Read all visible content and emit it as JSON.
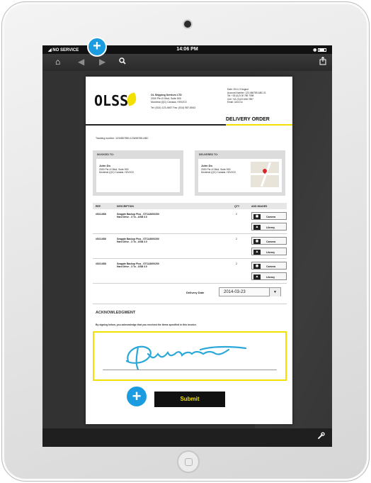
{
  "device": {
    "camera": "front-camera",
    "home_button": "home-button"
  },
  "status_bar": {
    "carrier": "NO SERVICE",
    "time": "14:06 PM"
  },
  "toolbar": {
    "home_icon": "home-icon",
    "back_icon": "back-icon",
    "forward_icon": "forward-icon",
    "search_icon": "search-icon",
    "share_icon": "share-icon"
  },
  "annotations": {
    "top_plus": "+",
    "bottom_plus": "+"
  },
  "company": {
    "logo": "OLSS",
    "name": "OL Shipping Services LTD",
    "address_line1": "2000 Pie-IX Blvd, Suite 500",
    "address_line2": "Montreal (QC) Canada, H0V2C0",
    "contact": "Tel: (514) 123-4567 Fax: (514) 987-6543"
  },
  "doc_meta": {
    "date": "Date: 2014, 5 August",
    "account": "Account Number: 123-456789-ABC-01",
    "tel": "Tel: +33 (0) 5 00 789 7098",
    "cell": "Cell: +41 (0)123 456 7897",
    "email": "Email: John Do"
  },
  "document": {
    "title": "DELIVERY ORDER",
    "tracking": "Tracking number: 1234567890-123456789-ABC"
  },
  "invoiced_to": {
    "label": "INVOICED TO:",
    "name": "John Do",
    "line1": "2000 Pie-IX Blvd, Suite 500",
    "line2": "Montreal (QC) Canada, H0V2C0"
  },
  "delivered_to": {
    "label": "DELIVERED TO:",
    "name": "John Do",
    "line1": "2000 Pie-IX Blvd, Suite 500",
    "line2": "Montreal (QC) Canada, H0V2C0"
  },
  "table": {
    "headers": {
      "ref": "REF.",
      "description": "DESCRIPTION",
      "qty": "QTY",
      "add_images": "ADD IMAGES"
    },
    "rows": [
      {
        "ref": "#521458",
        "desc1": "Seagate Backup Plus - STCA3000200",
        "desc2": "Hard Drive - 3 To - USB 3.0",
        "qty": "2"
      },
      {
        "ref": "#521458",
        "desc1": "Seagate Backup Plus - STCA3000200",
        "desc2": "Hard Drive - 3 To - USB 3.0",
        "qty": "2"
      },
      {
        "ref": "#521458",
        "desc1": "Seagate Backup Plus - STCA3000200",
        "desc2": "Hard Drive - 3 To - USB 3.0",
        "qty": "2"
      }
    ],
    "camera_label": "Camera",
    "library_label": "Library"
  },
  "delivery_date": {
    "label": "Delivery Date",
    "value": "2014-03-23"
  },
  "acknowledgment": {
    "title": "ACKNOWLEDGMENT",
    "text": "By signing below, you acknowledge that you received the items specified in this invoice."
  },
  "submit_label": "Submit",
  "colors": {
    "accent_yellow": "#f1e000",
    "plus_blue": "#1b9be0",
    "signature_blue": "#2aa8d8"
  }
}
